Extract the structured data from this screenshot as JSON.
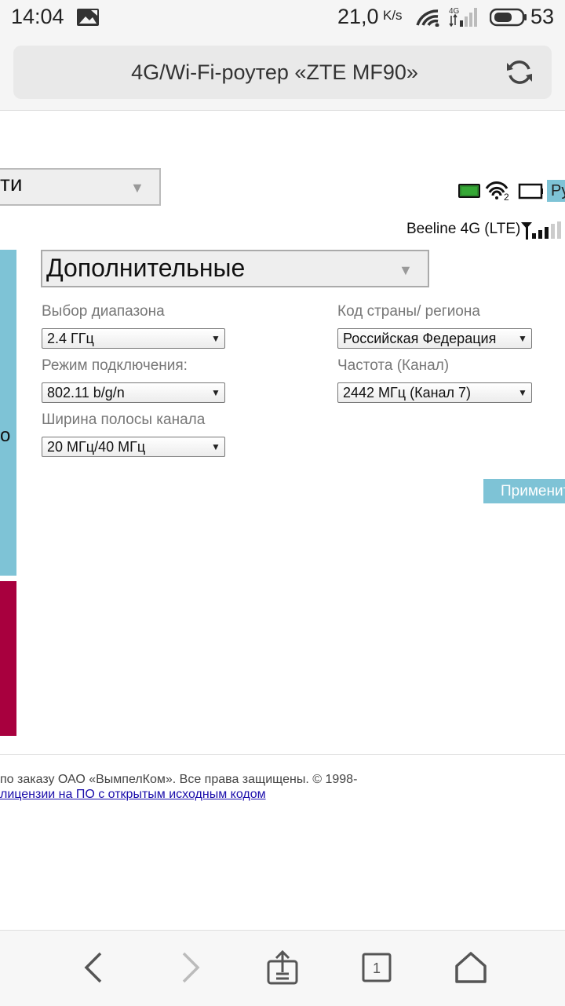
{
  "status_bar": {
    "time": "14:04",
    "speed": "21,0",
    "speed_unit": "K/s",
    "network": "4G",
    "battery_pct": "53"
  },
  "browser": {
    "url_title": "4G/Wi-Fi-роутер «ZTE MF90»",
    "tab_count": "1"
  },
  "header": {
    "top_select_text": "ти",
    "lang_button": "Ру",
    "wifi_clients": "2",
    "operator": "Beeline 4G (LTE)"
  },
  "sidebar": {
    "partial_text": "о"
  },
  "settings": {
    "section_select": "Дополнительные",
    "band_label": "Выбор диапазона",
    "band_value": "2.4 ГГц",
    "mode_label": "Режим подключения:",
    "mode_value": "802.11 b/g/n",
    "bandwidth_label": "Ширина полосы канала",
    "bandwidth_value": "20 МГц/40 МГц",
    "country_label": "Код страны/ региона",
    "country_value": "Российская Федерация",
    "channel_label": "Частота (Канал)",
    "channel_value": "2442 МГц (Канал 7)",
    "apply_button": "Применить"
  },
  "footer": {
    "copyright": "по заказу ОАО «ВымпелКом». Все права защищены. © 1998-",
    "license_link": "лицензии на ПО с открытым исходным кодом"
  },
  "colors": {
    "accent_blue": "#7ec3d6",
    "sidebar_red": "#a8003e"
  }
}
